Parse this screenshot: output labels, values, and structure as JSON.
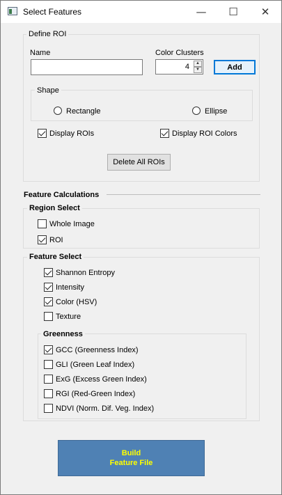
{
  "window": {
    "title": "Select Features",
    "minimize_glyph": "—",
    "maximize_glyph": "☐",
    "close_glyph": "✕"
  },
  "define_roi": {
    "group_title": "Define ROI",
    "name_label": "Name",
    "name_value": "",
    "color_clusters_label": "Color Clusters",
    "color_clusters_value": "4",
    "add_label": "Add",
    "shape": {
      "group_title": "Shape",
      "options": [
        {
          "label": "Rectangle",
          "checked": false
        },
        {
          "label": "Ellipse",
          "checked": false
        }
      ]
    },
    "display_rois_label": "Display ROIs",
    "display_rois_checked": true,
    "display_roi_colors_label": "Display ROI  Colors",
    "display_roi_colors_checked": true,
    "delete_all_label": "Delete All ROIs"
  },
  "feature_calculations": {
    "title": "Feature Calculations",
    "region_select": {
      "title": "Region Select",
      "items": [
        {
          "label": "Whole Image",
          "checked": false
        },
        {
          "label": "ROI",
          "checked": true
        }
      ]
    },
    "feature_select": {
      "title": "Feature Select",
      "items": [
        {
          "label": "Shannon Entropy",
          "checked": true
        },
        {
          "label": "Intensity",
          "checked": true
        },
        {
          "label": "Color (HSV)",
          "checked": true
        },
        {
          "label": "Texture",
          "checked": false
        }
      ],
      "greenness": {
        "title": "Greenness",
        "items": [
          {
            "label": "GCC (Greenness Index)",
            "checked": true
          },
          {
            "label": "GLI (Green Leaf Index)",
            "checked": false
          },
          {
            "label": "ExG (Excess Green Index)",
            "checked": false
          },
          {
            "label": "RGI (Red-Green Index)",
            "checked": false
          },
          {
            "label": "NDVI (Norm. Dif. Veg. Index)",
            "checked": false
          }
        ]
      }
    }
  },
  "build_button": {
    "line1": "Build",
    "line2": "Feature File",
    "text_color": "#ffff00",
    "bg_color": "#4f81b4"
  }
}
